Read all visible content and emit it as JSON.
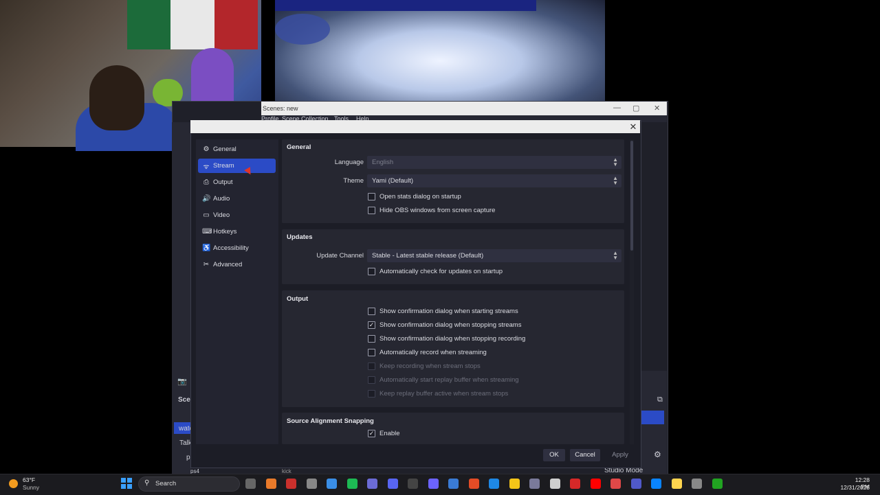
{
  "obs_window": {
    "title": "Scenes: new",
    "menu": [
      "Profile",
      "Scene Collection",
      "Tools",
      "Help"
    ],
    "scenes_label": "Scen",
    "scene_selected": "watc",
    "scene_items": [
      "Talk",
      "p",
      "ps4"
    ],
    "source_items": [
      "kick"
    ],
    "studio_mode_label": "Studio Mode"
  },
  "settings": {
    "sidebar": [
      {
        "label": "General",
        "icon": "gear-icon"
      },
      {
        "label": "Stream",
        "icon": "antenna-icon"
      },
      {
        "label": "Output",
        "icon": "output-icon"
      },
      {
        "label": "Audio",
        "icon": "speaker-icon"
      },
      {
        "label": "Video",
        "icon": "monitor-icon"
      },
      {
        "label": "Hotkeys",
        "icon": "keyboard-icon"
      },
      {
        "label": "Accessibility",
        "icon": "accessibility-icon"
      },
      {
        "label": "Advanced",
        "icon": "wrench-icon"
      }
    ],
    "selected": "Stream",
    "general": {
      "title": "General",
      "language_label": "Language",
      "language_value": "English",
      "theme_label": "Theme",
      "theme_value": "Yami (Default)",
      "open_stats": "Open stats dialog on startup",
      "hide_obs": "Hide OBS windows from screen capture"
    },
    "updates": {
      "title": "Updates",
      "channel_label": "Update Channel",
      "channel_value": "Stable - Latest stable release (Default)",
      "auto_check": "Automatically check for updates on startup"
    },
    "output": {
      "title": "Output",
      "options": [
        {
          "label": "Show confirmation dialog when starting streams",
          "checked": false,
          "enabled": true
        },
        {
          "label": "Show confirmation dialog when stopping streams",
          "checked": true,
          "enabled": true
        },
        {
          "label": "Show confirmation dialog when stopping recording",
          "checked": false,
          "enabled": true
        },
        {
          "label": "Automatically record when streaming",
          "checked": false,
          "enabled": true
        },
        {
          "label": "Keep recording when stream stops",
          "checked": false,
          "enabled": false
        },
        {
          "label": "Automatically start replay buffer when streaming",
          "checked": false,
          "enabled": false
        },
        {
          "label": "Keep replay buffer active when stream stops",
          "checked": false,
          "enabled": false
        }
      ]
    },
    "snapping": {
      "title": "Source Alignment Snapping",
      "enable": "Enable",
      "enable_checked": true
    },
    "buttons": {
      "ok": "OK",
      "cancel": "Cancel",
      "apply": "Apply"
    },
    "close_glyph": "✕"
  },
  "taskbar": {
    "weather_temp": "63°F",
    "weather_cond": "Sunny",
    "search_placeholder": "Search",
    "time": "12:28 PM",
    "date": "12/31/2025"
  }
}
